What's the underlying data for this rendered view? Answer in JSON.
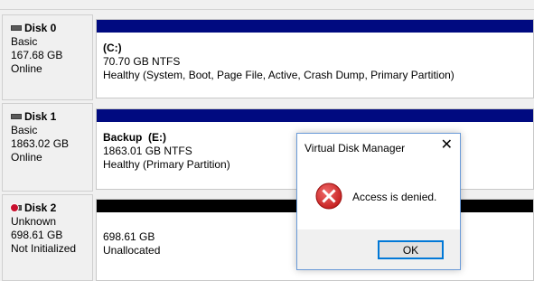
{
  "disks": [
    {
      "name": "Disk 0",
      "type": "Basic",
      "size": "167.68 GB",
      "status": "Online",
      "icon": "disk-icon"
    },
    {
      "name": "Disk 1",
      "type": "Basic",
      "size": "1863.02 GB",
      "status": "Online",
      "icon": "disk-icon"
    },
    {
      "name": "Disk 2",
      "type": "Unknown",
      "size": "698.61 GB",
      "status": "Not Initialized",
      "icon": "disk-error-icon"
    }
  ],
  "partitions": [
    {
      "label": "(C:)",
      "size_fs": "70.70 GB NTFS",
      "health": "Healthy (System, Boot, Page File, Active, Crash Dump, Primary Partition)"
    },
    {
      "label": "Backup  (E:)",
      "size_fs": "1863.01 GB NTFS",
      "health": "Healthy (Primary Partition)"
    },
    {
      "size": "698.61 GB",
      "state": "Unallocated"
    }
  ],
  "colors": {
    "primary_bar": "#000a80",
    "unallocated_bar": "#000000"
  },
  "dialog": {
    "title": "Virtual Disk Manager",
    "close_label": "✕",
    "message": "Access is denied.",
    "icon": "error-icon",
    "ok_label": "OK"
  }
}
